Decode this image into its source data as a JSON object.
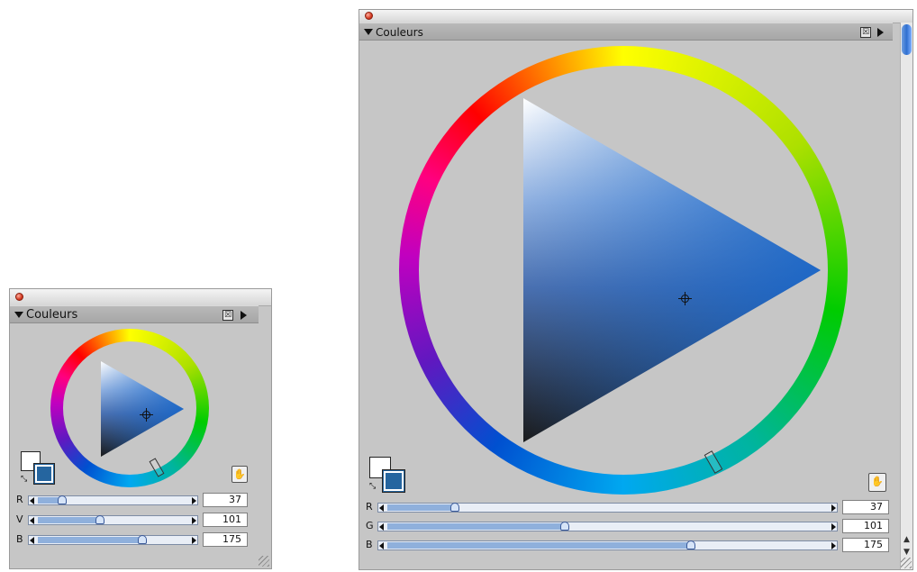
{
  "panel_small": {
    "title": "Couleurs",
    "close_box": "☒",
    "swap_glyph": "⤡",
    "eyedropper_icon": "eyedropper-icon",
    "sliders": [
      {
        "label": "R",
        "value": "37",
        "level": 0.145
      },
      {
        "label": "V",
        "value": "101",
        "level": 0.396
      },
      {
        "label": "B",
        "value": "175",
        "level": 0.686
      }
    ]
  },
  "panel_large": {
    "title": "Couleurs",
    "close_box": "☒",
    "swap_glyph": "⤡",
    "eyedropper_icon": "eyedropper-icon",
    "sliders": [
      {
        "label": "R",
        "value": "37",
        "level": 0.145
      },
      {
        "label": "G",
        "value": "101",
        "level": 0.396
      },
      {
        "label": "B",
        "value": "175",
        "level": 0.686
      }
    ]
  },
  "colors": {
    "foreground_swatch": "#ffffff",
    "background_swatch": "#25659f",
    "slider_fill": "#8fb0dc",
    "close_button": "#d43a22"
  }
}
